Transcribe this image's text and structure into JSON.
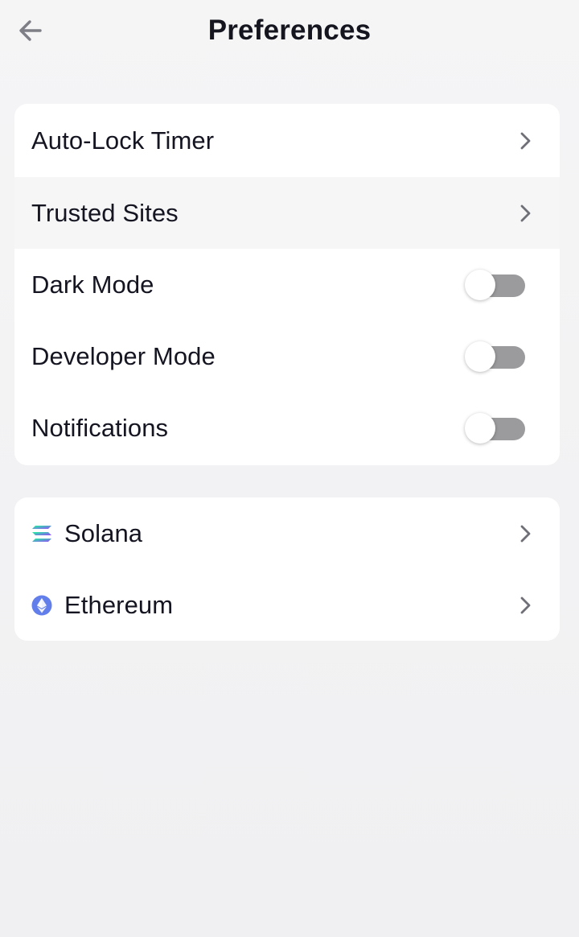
{
  "header": {
    "title": "Preferences",
    "back_icon": "arrow-left-icon"
  },
  "settings": {
    "items": [
      {
        "label": "Auto-Lock Timer",
        "type": "link"
      },
      {
        "label": "Trusted Sites",
        "type": "link"
      },
      {
        "label": "Dark Mode",
        "type": "toggle",
        "on": false
      },
      {
        "label": "Developer Mode",
        "type": "toggle",
        "on": false
      },
      {
        "label": "Notifications",
        "type": "toggle",
        "on": false
      }
    ]
  },
  "networks": {
    "items": [
      {
        "label": "Solana",
        "icon": "solana-icon"
      },
      {
        "label": "Ethereum",
        "icon": "ethereum-icon"
      }
    ]
  },
  "colors": {
    "toggle_off": "#9b9b9d",
    "chevron": "#6f7077",
    "ethereum": "#627eea",
    "solana_top": "#19fb9b",
    "solana_bottom": "#9945ff"
  }
}
